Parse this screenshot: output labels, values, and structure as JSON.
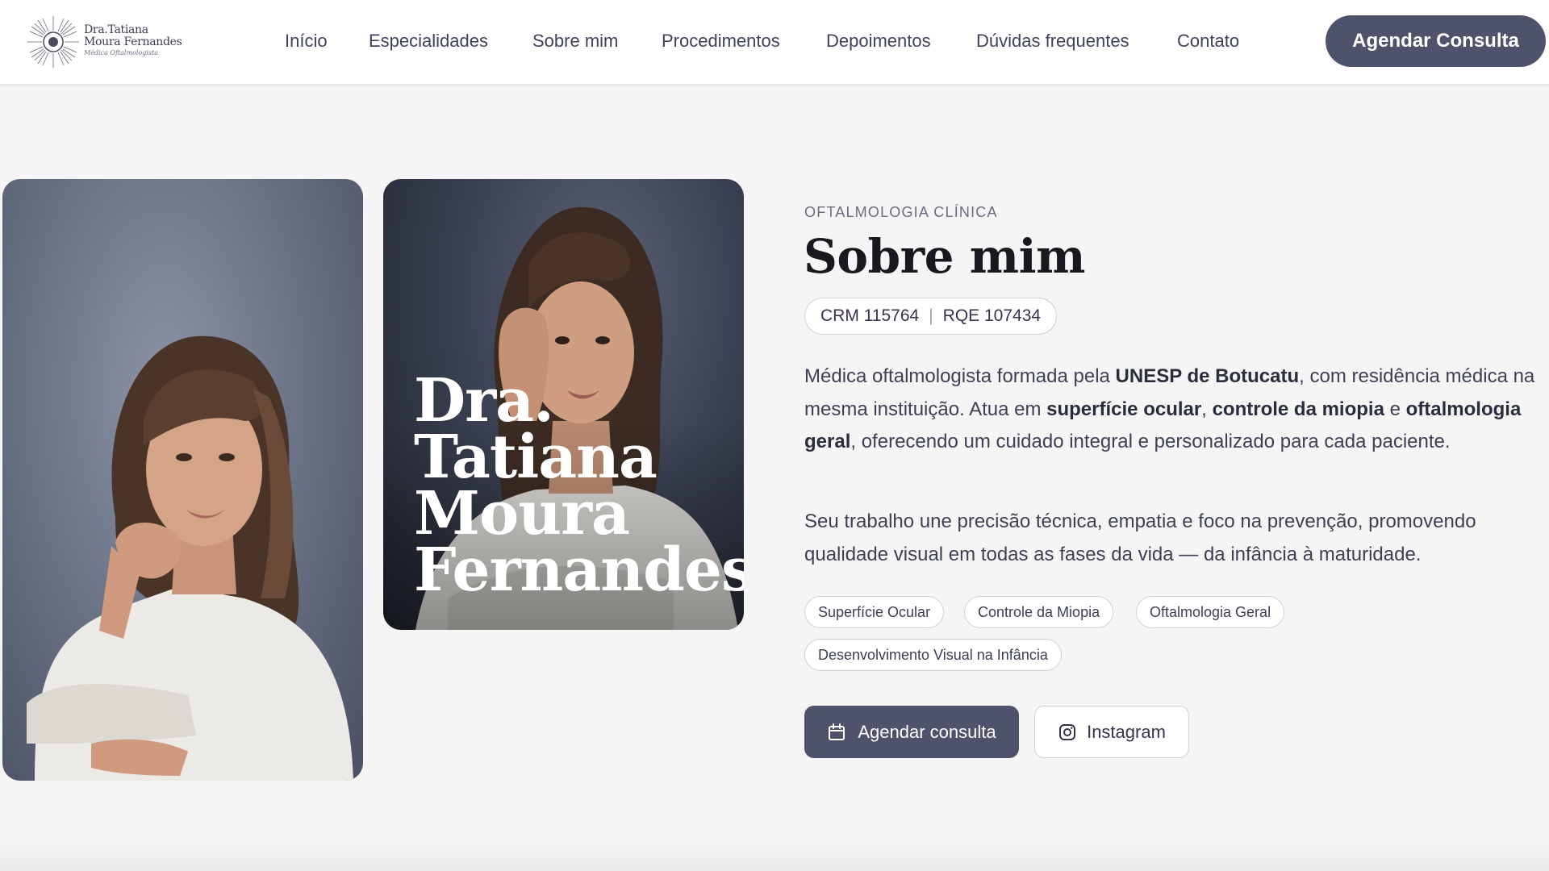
{
  "logo": {
    "line1": "Dra.Tatiana",
    "line2": "Moura Fernandes",
    "subtitle": "Médica Oftalmologista"
  },
  "nav": {
    "items": [
      "Início",
      "Especialidades",
      "Sobre mim",
      "Procedimentos",
      "Depoimentos",
      "Dúvidas frequentes",
      "Contato"
    ],
    "cta": "Agendar Consulta"
  },
  "hero": {
    "overlay_name": [
      "Dra.",
      "Tatiana",
      "Moura",
      "Fernandes"
    ],
    "eyebrow": "OFTALMOLOGIA CLÍNICA",
    "title": "Sobre mim",
    "crm": "CRM 115764",
    "separator": "|",
    "rqe": "RQE 107434",
    "p1": {
      "t1": "Médica oftalmologista formada pela ",
      "b1": "UNESP de Botucatu",
      "t2": ", com residência médica na mesma instituição. Atua em ",
      "b2": "superfície ocular",
      "t3": ", ",
      "b3": "controle da miopia",
      "t4": " e ",
      "b4": "oftalmologia geral",
      "t5": ", oferecendo um cuidado integral e personalizado para cada paciente."
    },
    "p2": "Seu trabalho une precisão técnica, empatia e foco na prevenção, promovendo qualidade visual em todas as fases da vida — da infância à maturidade.",
    "tags": [
      "Superfície Ocular",
      "Controle da Miopia",
      "Oftalmologia Geral",
      "Desenvolvimento Visual na Infância"
    ],
    "buttons": {
      "primary": "Agendar consulta",
      "secondary": "Instagram"
    }
  },
  "colors": {
    "accent": "#4f526b",
    "background": "#f5f5f5",
    "header": "#ffffff"
  },
  "icons": {
    "primary_button": "calendar-icon",
    "secondary_button": "instagram-icon",
    "logo": "sunburst-eye-icon"
  }
}
